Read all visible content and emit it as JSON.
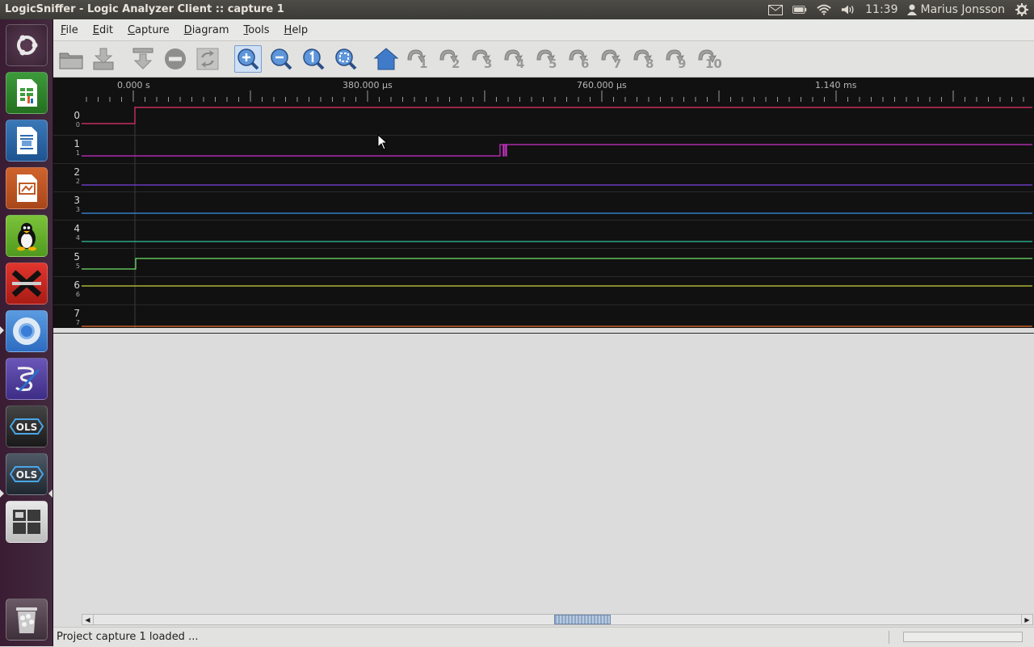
{
  "window": {
    "title": "LogicSniffer - Logic Analyzer Client :: capture 1"
  },
  "system_tray": {
    "time": "11:39",
    "user": "Marius Jonsson"
  },
  "launcher": {
    "items": [
      {
        "name": "dash-home-icon"
      },
      {
        "name": "libreoffice-calc-icon"
      },
      {
        "name": "libreoffice-writer-icon"
      },
      {
        "name": "libreoffice-impress-icon"
      },
      {
        "name": "tux-app-icon"
      },
      {
        "name": "x-app-icon"
      },
      {
        "name": "chromium-icon"
      },
      {
        "name": "emacs-icon"
      },
      {
        "name": "ols-app-icon-1",
        "label": "OLS"
      },
      {
        "name": "ols-app-icon-2",
        "label": "OLS"
      },
      {
        "name": "workspace-switcher-icon"
      },
      {
        "name": "trash-icon"
      }
    ]
  },
  "menubar": {
    "items": [
      {
        "mnemonic": "F",
        "rest": "ile"
      },
      {
        "mnemonic": "E",
        "rest": "dit"
      },
      {
        "mnemonic": "C",
        "rest": "apture"
      },
      {
        "mnemonic": "D",
        "rest": "iagram"
      },
      {
        "mnemonic": "T",
        "rest": "ools"
      },
      {
        "mnemonic": "H",
        "rest": "elp"
      }
    ]
  },
  "toolbar": {
    "cursor_labels": [
      "1",
      "2",
      "3",
      "4",
      "5",
      "6",
      "7",
      "8",
      "9",
      "10"
    ]
  },
  "timeline": {
    "labels": [
      "0.000 s",
      "380.000 µs",
      "760.000 µs",
      "1.140 ms"
    ]
  },
  "channels": [
    {
      "index": "0",
      "sub": "0",
      "color": "#e8336b"
    },
    {
      "index": "1",
      "sub": "1",
      "color": "#c832c8"
    },
    {
      "index": "2",
      "sub": "2",
      "color": "#7c43e0"
    },
    {
      "index": "3",
      "sub": "3",
      "color": "#3d92e8"
    },
    {
      "index": "4",
      "sub": "4",
      "color": "#2fc4a0"
    },
    {
      "index": "5",
      "sub": "5",
      "color": "#6fe36a"
    },
    {
      "index": "6",
      "sub": "6",
      "color": "#c9d43a"
    },
    {
      "index": "7",
      "sub": "7",
      "color": "#e8732d"
    }
  ],
  "statusbar": {
    "text": "Project capture 1 loaded ..."
  }
}
